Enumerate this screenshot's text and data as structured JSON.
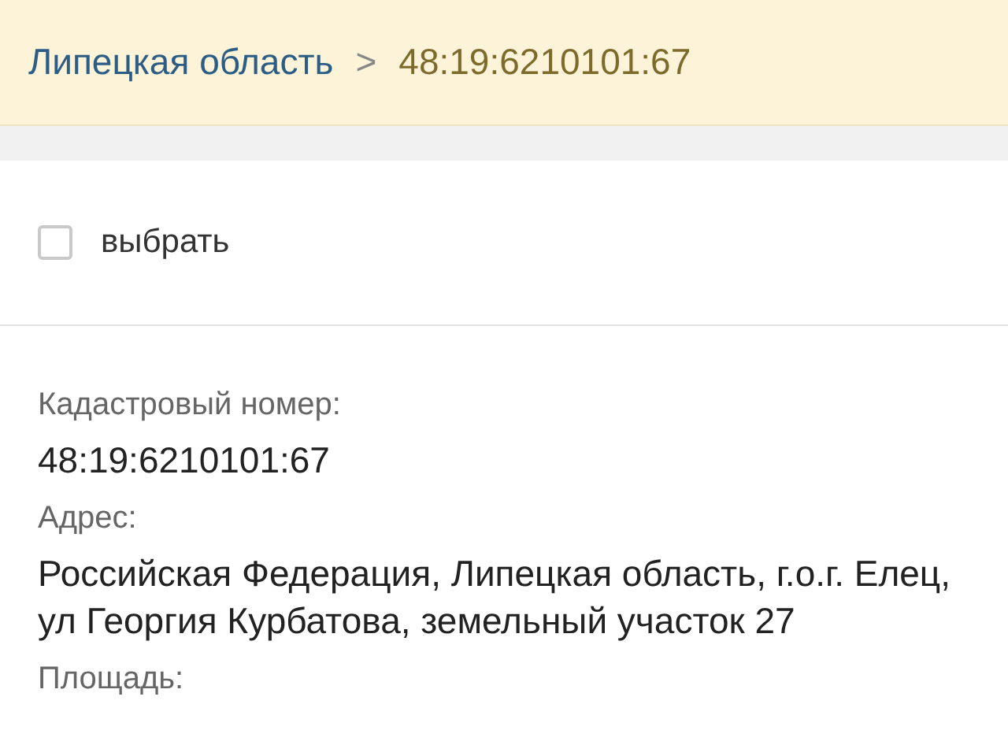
{
  "breadcrumb": {
    "region": "Липецкая область",
    "separator": ">",
    "current": "48:19:6210101:67"
  },
  "select": {
    "label": "выбрать",
    "checked": false
  },
  "fields": [
    {
      "label": "Кадастровый номер:",
      "value": "48:19:6210101:67"
    },
    {
      "label": "Адрес:",
      "value": "Российская Федерация, Липецкая область, г.о.г. Елец, ул Георгия Курбатова, земельный участок 27"
    },
    {
      "label": "Площадь:"
    }
  ]
}
